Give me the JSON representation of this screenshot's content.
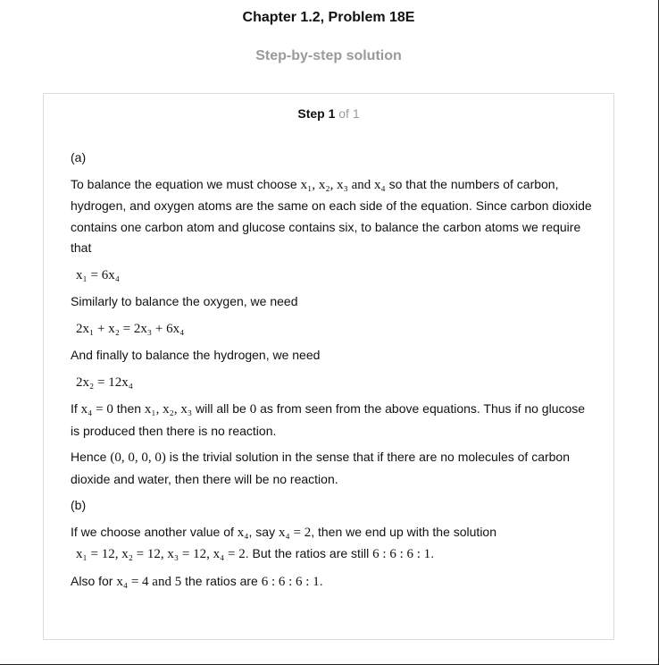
{
  "header": {
    "chapter": "Chapter 1.2, Problem 18E",
    "subtitle": "Step-by-step solution"
  },
  "step": {
    "label": "Step 1",
    "of": "of 1"
  },
  "content": {
    "a_label": "(a)",
    "para1_a": "To balance the equation we must choose",
    "para1_math": "x₁, x₂, x₃ and x₄",
    "para1_b": "so that the numbers of carbon, hydrogen, and oxygen atoms are the same on each side of the equation. Since carbon dioxide contains one carbon atom and glucose contains six, to balance the carbon atoms we require that",
    "eq1": "x₁ = 6x₄",
    "para2": "Similarly to balance the oxygen, we need",
    "eq2": "2x₁ + x₂ = 2x₃ + 6x₄",
    "para3": "And finally to balance the hydrogen, we need",
    "eq3": "2x₂ = 12x₄",
    "para4_a": "If",
    "para4_m1": "x₄ = 0",
    "para4_b": "then",
    "para4_m2": "x₁, x₂, x₃",
    "para4_c": "will all be",
    "para4_m3": "0",
    "para4_d": "as from seen from the above equations. Thus if no glucose is produced then there is no reaction.",
    "para5_a": "Hence",
    "para5_m": "(0, 0, 0, 0)",
    "para5_b": "is the trivial solution in the sense that if there are no molecules of carbon dioxide and water, then there will be no reaction.",
    "b_label": "(b)",
    "para6_a": "If we choose another value of",
    "para6_m1": "x₄",
    "para6_b": ", say",
    "para6_m2": "x₄ = 2",
    "para6_c": ", then we end up with the solution",
    "para6_m3": "x₁ = 12, x₂ = 12, x₃ = 12, x₄ = 2",
    "para6_d": ". But the ratios are still",
    "para6_m4": "6 : 6 : 6 : 1",
    "para6_e": ".",
    "para7_a": "Also for",
    "para7_m1": "x₄ = 4 and 5",
    "para7_b": "the ratios are",
    "para7_m2": "6 : 6 : 6 : 1",
    "para7_c": "."
  }
}
